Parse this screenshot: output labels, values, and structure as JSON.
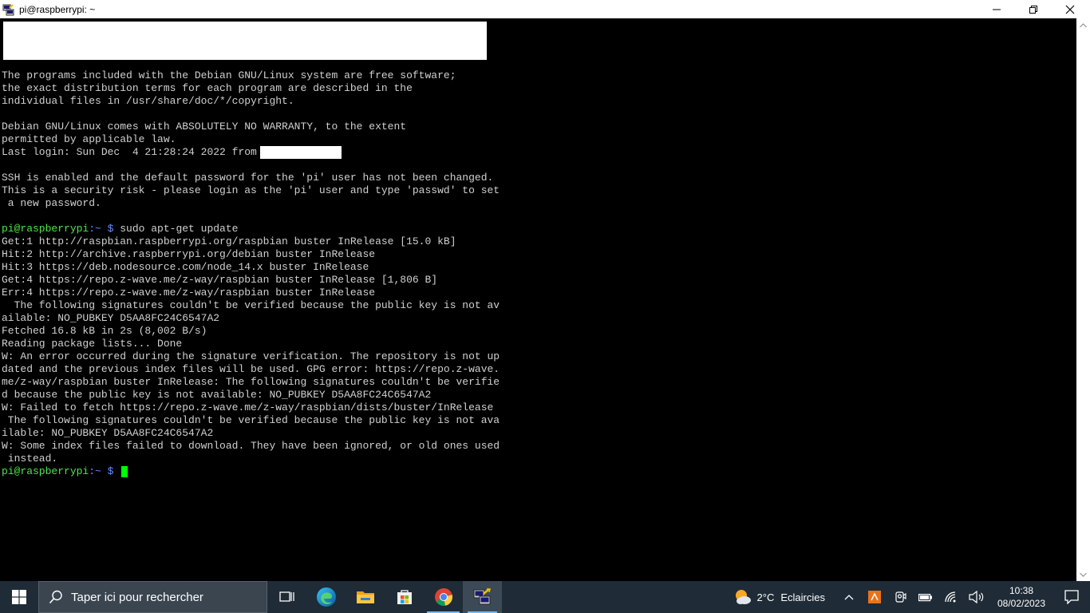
{
  "window": {
    "title": "pi@raspberrypi: ~"
  },
  "terminal": {
    "lines": [
      {
        "type": "text",
        "text": "The programs included with the Debian GNU/Linux system are free software;"
      },
      {
        "type": "text",
        "text": "the exact distribution terms for each program are described in the"
      },
      {
        "type": "text",
        "text": "individual files in /usr/share/doc/*/copyright."
      },
      {
        "type": "text",
        "text": ""
      },
      {
        "type": "text",
        "text": "Debian GNU/Linux comes with ABSOLUTELY NO WARRANTY, to the extent"
      },
      {
        "type": "text",
        "text": "permitted by applicable law."
      },
      {
        "type": "redacted",
        "text": "Last login: Sun Dec  4 21:28:24 2022 from"
      },
      {
        "type": "text",
        "text": ""
      },
      {
        "type": "text",
        "text": "SSH is enabled and the default password for the 'pi' user has not been changed."
      },
      {
        "type": "text",
        "text": "This is a security risk - please login as the 'pi' user and type 'passwd' to set"
      },
      {
        "type": "text",
        "text": " a new password."
      },
      {
        "type": "text",
        "text": ""
      },
      {
        "type": "prompt",
        "user": "pi@raspberrypi",
        "path": ":~ $",
        "cmd": " sudo apt-get update"
      },
      {
        "type": "text",
        "text": "Get:1 http://raspbian.raspberrypi.org/raspbian buster InRelease [15.0 kB]"
      },
      {
        "type": "text",
        "text": "Hit:2 http://archive.raspberrypi.org/debian buster InRelease"
      },
      {
        "type": "text",
        "text": "Hit:3 https://deb.nodesource.com/node_14.x buster InRelease"
      },
      {
        "type": "text",
        "text": "Get:4 https://repo.z-wave.me/z-way/raspbian buster InRelease [1,806 B]"
      },
      {
        "type": "text",
        "text": "Err:4 https://repo.z-wave.me/z-way/raspbian buster InRelease"
      },
      {
        "type": "text",
        "text": "  The following signatures couldn't be verified because the public key is not av"
      },
      {
        "type": "text",
        "text": "ailable: NO_PUBKEY D5AA8FC24C6547A2"
      },
      {
        "type": "text",
        "text": "Fetched 16.8 kB in 2s (8,002 B/s)"
      },
      {
        "type": "text",
        "text": "Reading package lists... Done"
      },
      {
        "type": "text",
        "text": "W: An error occurred during the signature verification. The repository is not up"
      },
      {
        "type": "text",
        "text": "dated and the previous index files will be used. GPG error: https://repo.z-wave."
      },
      {
        "type": "text",
        "text": "me/z-way/raspbian buster InRelease: The following signatures couldn't be verifie"
      },
      {
        "type": "text",
        "text": "d because the public key is not available: NO_PUBKEY D5AA8FC24C6547A2"
      },
      {
        "type": "text",
        "text": "W: Failed to fetch https://repo.z-wave.me/z-way/raspbian/dists/buster/InRelease"
      },
      {
        "type": "text",
        "text": " The following signatures couldn't be verified because the public key is not ava"
      },
      {
        "type": "text",
        "text": "ilable: NO_PUBKEY D5AA8FC24C6547A2"
      },
      {
        "type": "text",
        "text": "W: Some index files failed to download. They have been ignored, or old ones used"
      },
      {
        "type": "text",
        "text": " instead."
      },
      {
        "type": "prompt-cursor",
        "user": "pi@raspberrypi",
        "path": ":~ $"
      }
    ]
  },
  "taskbar": {
    "search_placeholder": "Taper ici pour rechercher",
    "icons": [
      {
        "name": "task-view-icon"
      },
      {
        "name": "edge-icon"
      },
      {
        "name": "file-explorer-icon"
      },
      {
        "name": "store-icon"
      },
      {
        "name": "chrome-icon"
      },
      {
        "name": "putty-icon"
      }
    ],
    "weather": {
      "temp": "2°C",
      "desc": "Eclaircies"
    },
    "clock": {
      "time": "10:38",
      "date": "08/02/2023"
    }
  },
  "colors": {
    "terminal_bg": "#000000",
    "terminal_fg": "#d0d0d0",
    "prompt_user": "#4ee44e",
    "prompt_path": "#6b8cff",
    "cursor": "#00ff00",
    "taskbar_bg": "#1f2b36"
  }
}
